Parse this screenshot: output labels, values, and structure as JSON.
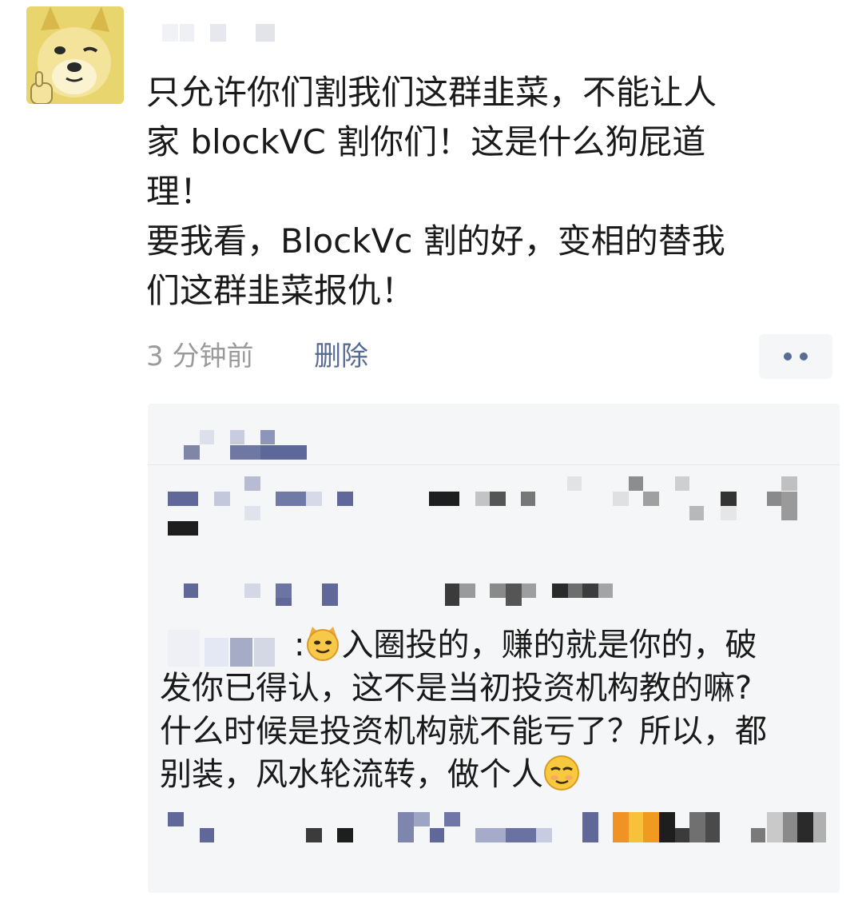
{
  "post": {
    "author_avatar_icon": "doge-thumbs-up-avatar",
    "lines": [
      "只允许你们割我们这群韭菜，不能让人",
      "家 blockVC 割你们！这是什么狗屁道",
      "理！",
      "要我看，BlockVc 割的好，变相的替我",
      "们这群韭菜报仇！"
    ],
    "time": "3 分钟前",
    "delete_label": "删除",
    "more_icon": "two-dots-more-icon"
  },
  "comment": {
    "text_parts": [
      ":",
      "入圈投的，赚的就是你的，破"
    ],
    "lines": [
      "发你已得认，这不是当初投资机构教的嘛?",
      "什么时候是投资机构就不能亏了？所以，都",
      "别装，风水轮流转，做个人"
    ],
    "emoji_1": "cat-smirk-emoji",
    "emoji_2": "smug-face-emoji"
  },
  "colors": {
    "link": "#576b95",
    "meta": "#9b9b9b",
    "panel": "#f5f6f8",
    "text": "#1a1a1a"
  }
}
